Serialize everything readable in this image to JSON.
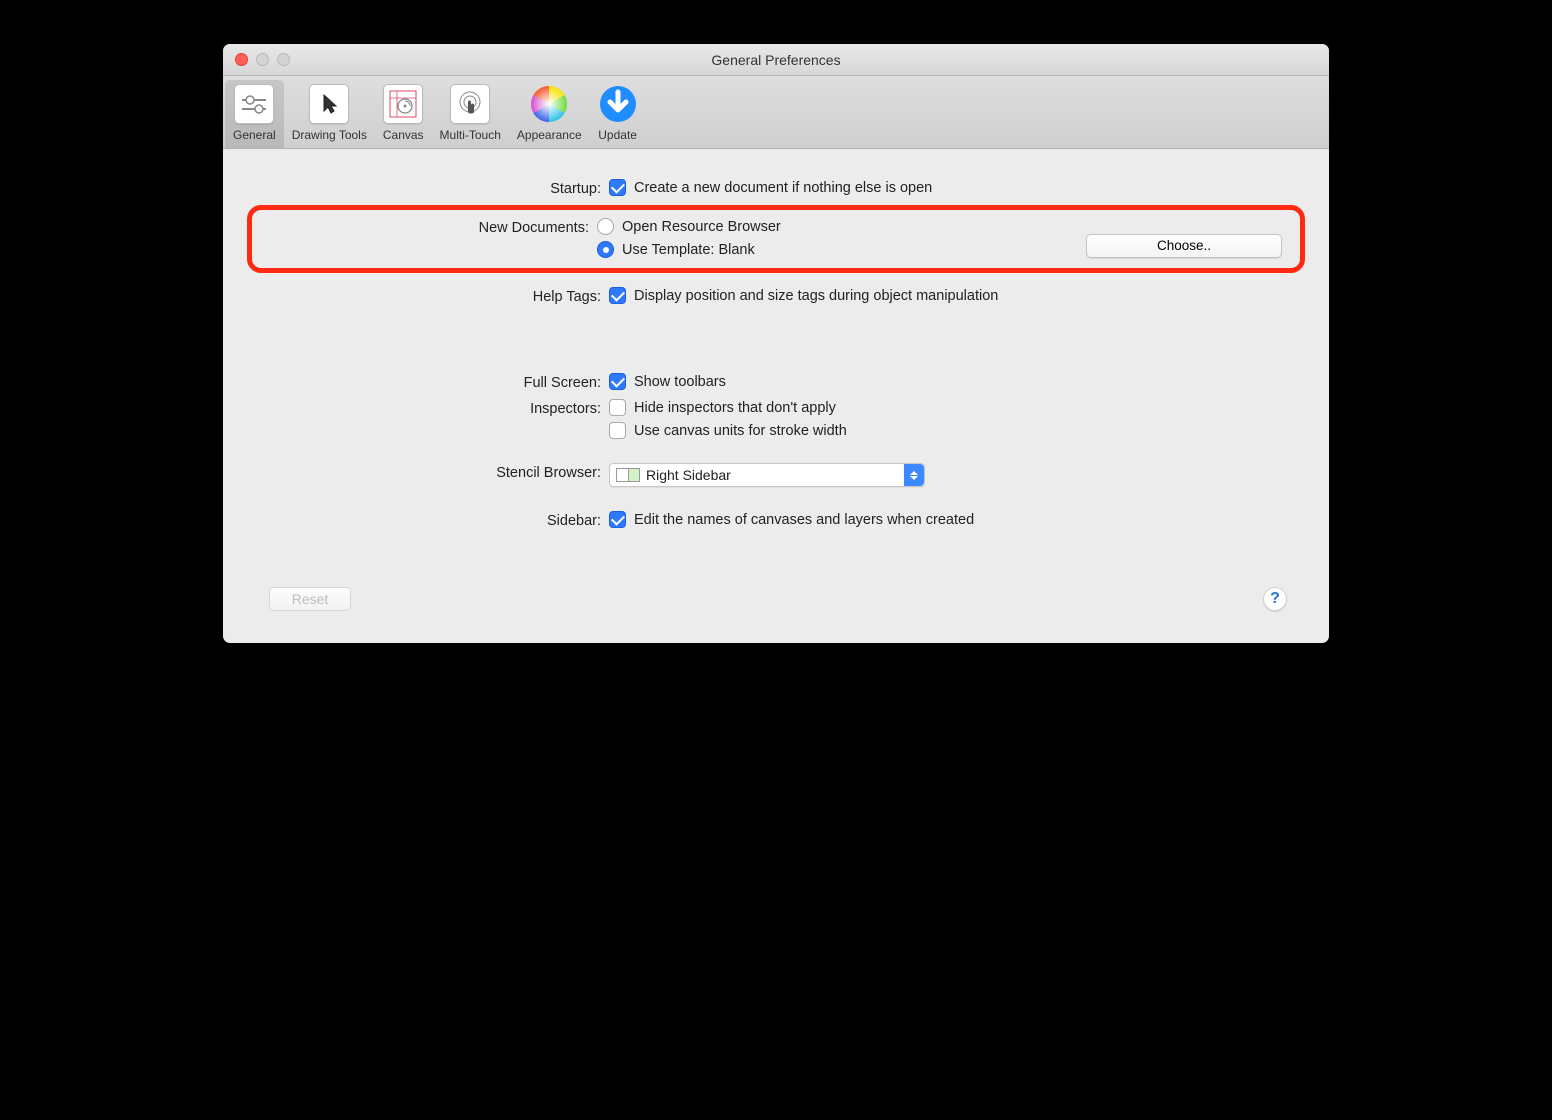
{
  "window": {
    "title": "General Preferences"
  },
  "toolbar": {
    "items": [
      {
        "label": "General",
        "selected": true
      },
      {
        "label": "Drawing Tools"
      },
      {
        "label": "Canvas"
      },
      {
        "label": "Multi-Touch"
      },
      {
        "label": "Appearance"
      },
      {
        "label": "Update"
      }
    ]
  },
  "sections": {
    "startup": {
      "label": "Startup:",
      "create_new_doc": "Create a new document if nothing else is open"
    },
    "new_documents": {
      "label": "New Documents:",
      "open_resource_browser": "Open Resource Browser",
      "use_template": "Use Template: Blank",
      "choose": "Choose.."
    },
    "help_tags": {
      "label": "Help Tags:",
      "display_tags": "Display position and size tags during object manipulation"
    },
    "full_screen": {
      "label": "Full Screen:",
      "show_toolbars": "Show toolbars"
    },
    "inspectors": {
      "label": "Inspectors:",
      "hide_inspectors": "Hide inspectors that don't apply",
      "canvas_units": "Use canvas units for stroke width"
    },
    "stencil_browser": {
      "label": "Stencil Browser:",
      "value": "Right Sidebar"
    },
    "sidebar": {
      "label": "Sidebar:",
      "edit_names": "Edit the names of canvases and layers when created"
    }
  },
  "footer": {
    "reset": "Reset",
    "help": "?"
  }
}
